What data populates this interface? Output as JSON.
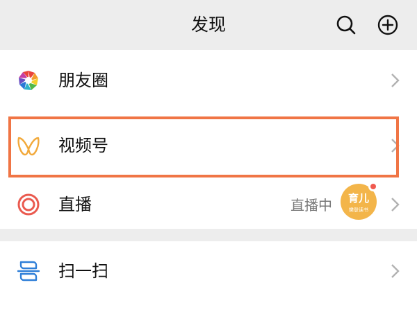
{
  "header": {
    "title": "发现",
    "search_icon": "search-icon",
    "plus_icon": "plus-circle-icon"
  },
  "cells": {
    "moments": {
      "label": "朋友圈",
      "icon": "moments-aperture-icon"
    },
    "channels": {
      "label": "视频号",
      "icon": "channels-butterfly-icon",
      "highlighted": true,
      "highlight_color": "#f07545"
    },
    "live": {
      "label": "直播",
      "icon": "live-ring-icon",
      "status": "直播中",
      "avatar_text": "育儿",
      "avatar_sub": "樊登读书",
      "avatar_color": "#f3b54a",
      "badge_color": "#f05a4f"
    },
    "scan": {
      "label": "扫一扫",
      "icon": "scan-icon"
    }
  },
  "colors": {
    "background": "#ededed",
    "cell": "#ffffff",
    "chevron": "#b2b2b2",
    "accent": "#f07545"
  }
}
